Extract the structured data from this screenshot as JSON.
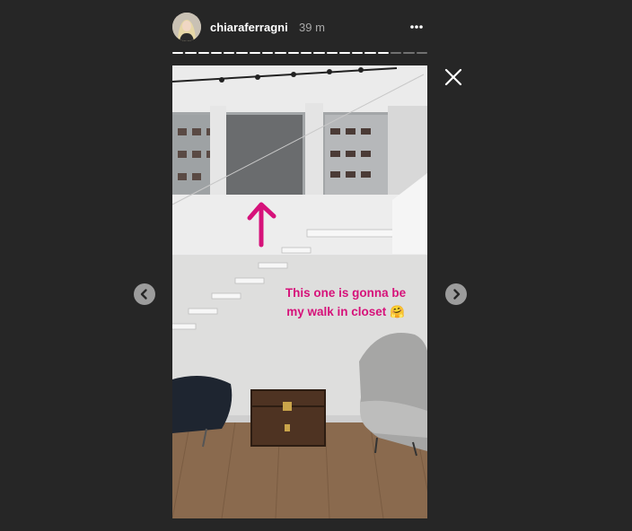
{
  "story": {
    "username": "chiaraferragni",
    "timestamp": "39 m",
    "caption_line1": "This one is gonna be",
    "caption_line2": "my walk in closet",
    "caption_emoji": "🤗",
    "progress": {
      "total_segments": 20,
      "completed_segments": 17
    }
  },
  "controls": {
    "more_icon": "more-horizontal-icon",
    "close_icon": "close-icon",
    "prev_icon": "chevron-left-icon",
    "next_icon": "chevron-right-icon"
  },
  "colors": {
    "background": "#262626",
    "caption": "#d6127a",
    "arrow": "#d6127a",
    "muted_text": "#a8a8a8"
  }
}
